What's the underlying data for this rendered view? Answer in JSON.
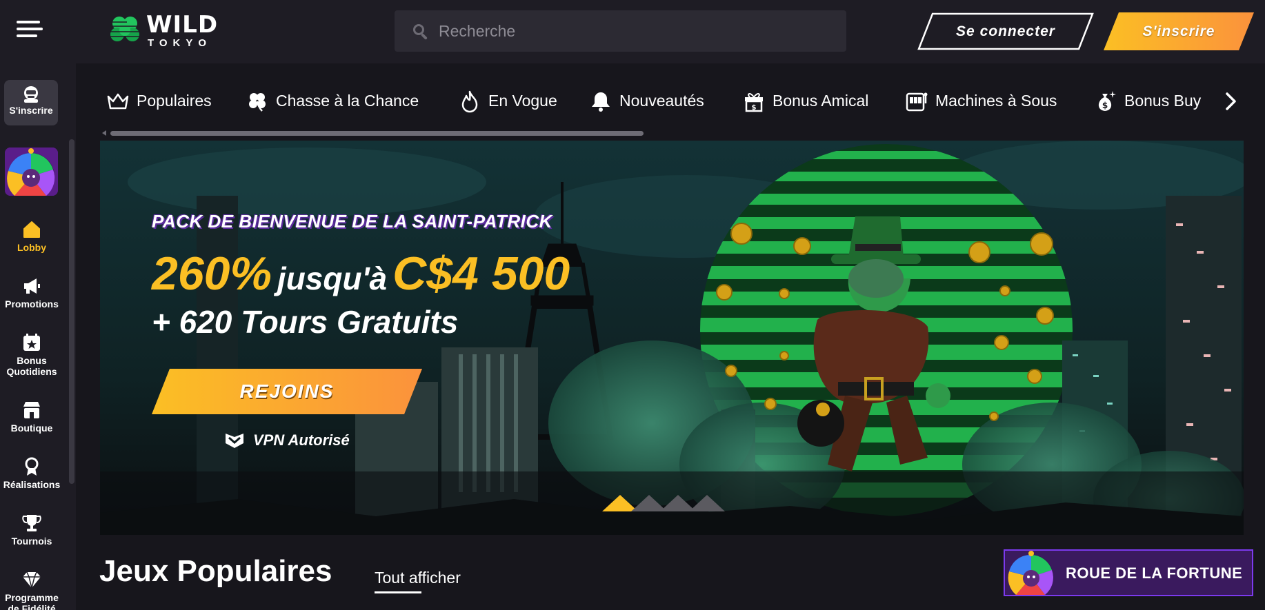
{
  "brand": {
    "name_top": "WILD",
    "name_bottom": "TOKYO",
    "clover_color": "#22c55e"
  },
  "search": {
    "placeholder": "Recherche"
  },
  "header": {
    "login_label": "Se connecter",
    "signup_label": "S'inscrire",
    "accent": "#fbbf24"
  },
  "sidebar": {
    "signup_label": "S'inscrire",
    "items": [
      {
        "label": "Lobby",
        "icon": "home-icon",
        "active": true
      },
      {
        "label": "Promotions",
        "icon": "megaphone-icon"
      },
      {
        "label": "Bonus Quotidiens",
        "icon": "calendar-star-icon"
      },
      {
        "label": "Boutique",
        "icon": "shop-icon"
      },
      {
        "label": "Réalisations",
        "icon": "ribbon-icon"
      },
      {
        "label": "Tournois",
        "icon": "trophy-icon"
      },
      {
        "label": "Programme de Fidélité",
        "icon": "diamond-icon"
      }
    ]
  },
  "categories": [
    {
      "label": "Populaires",
      "icon": "crown-icon"
    },
    {
      "label": "Chasse à la Chance",
      "icon": "clover-icon"
    },
    {
      "label": "En Vogue",
      "icon": "flame-icon"
    },
    {
      "label": "Nouveautés",
      "icon": "bell-icon"
    },
    {
      "label": "Bonus Amical",
      "icon": "gift-icon"
    },
    {
      "label": "Machines à Sous",
      "icon": "slot-machine-icon"
    },
    {
      "label": "Bonus Buy",
      "icon": "money-bag-icon"
    }
  ],
  "banner": {
    "kicker": "PACK DE BIENVENUE DE LA SAINT-PATRICK",
    "percent": "260%",
    "connector": "jusqu'à",
    "amount": "C$4 500",
    "spins": "+ 620 Tours Gratuits",
    "cta": "REJOINS",
    "vpn": "VPN Autorisé",
    "slide_count": 4,
    "active_slide": 1
  },
  "section": {
    "title": "Jeux Populaires",
    "see_all": "Tout afficher"
  },
  "wheel_banner": {
    "label": "ROUE DE LA FORTUNE"
  }
}
